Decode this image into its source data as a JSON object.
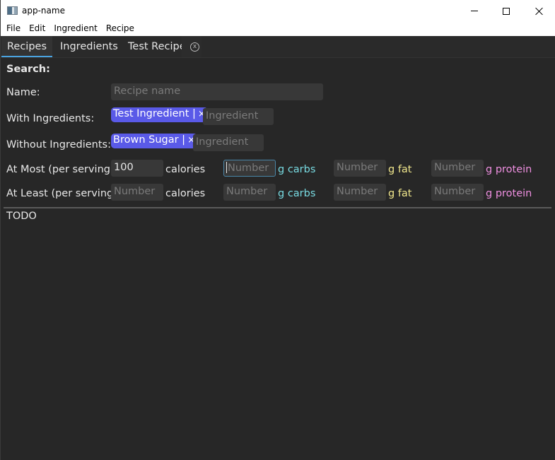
{
  "window": {
    "title": "app-name",
    "controls": [
      "minimize",
      "maximize",
      "close"
    ]
  },
  "menubar": {
    "items": [
      "File",
      "Edit",
      "Ingredient",
      "Recipe"
    ]
  },
  "tabs": [
    {
      "label": "Recipes",
      "active": true
    },
    {
      "label": "Ingredients",
      "active": false
    },
    {
      "label": "Test Recipe",
      "active": false,
      "closable": true
    }
  ],
  "tab_close_glyph": "⊗",
  "search": {
    "title": "Search:",
    "name_label": "Name:",
    "name_placeholder": "Recipe name",
    "name_value": "",
    "with_label": "With Ingredients:",
    "with_chips": [
      {
        "label": "Test Ingredient |",
        "remove": "×"
      }
    ],
    "with_placeholder": "Ingredient",
    "without_label": "Without Ingredients:",
    "without_chips": [
      {
        "label": "Brown Sugar |",
        "remove": "×"
      }
    ],
    "without_placeholder": "Ingredient",
    "at_most": {
      "label": "At Most (per serving)",
      "calories_value": "100",
      "calories_unit": "calories",
      "carbs_placeholder": "Number",
      "carbs_unit": "g carbs",
      "fat_placeholder": "Number",
      "fat_unit": "g fat",
      "protein_placeholder": "Number",
      "protein_unit": "g protein"
    },
    "at_least": {
      "label": "At Least (per serving)",
      "calories_placeholder": "Number",
      "calories_unit": "calories",
      "carbs_placeholder": "Number",
      "carbs_unit": "g carbs",
      "fat_placeholder": "Number",
      "fat_unit": "g fat",
      "protein_placeholder": "Number",
      "protein_unit": "g protein"
    }
  },
  "results_text": "TODO",
  "colors": {
    "accent_tab": "#4aa3e0",
    "chip": "#5a5ae8",
    "carbs": "#78dbe2",
    "fat": "#f0e68c",
    "protein": "#ee8fe0",
    "focus_border": "#4a86a8"
  }
}
